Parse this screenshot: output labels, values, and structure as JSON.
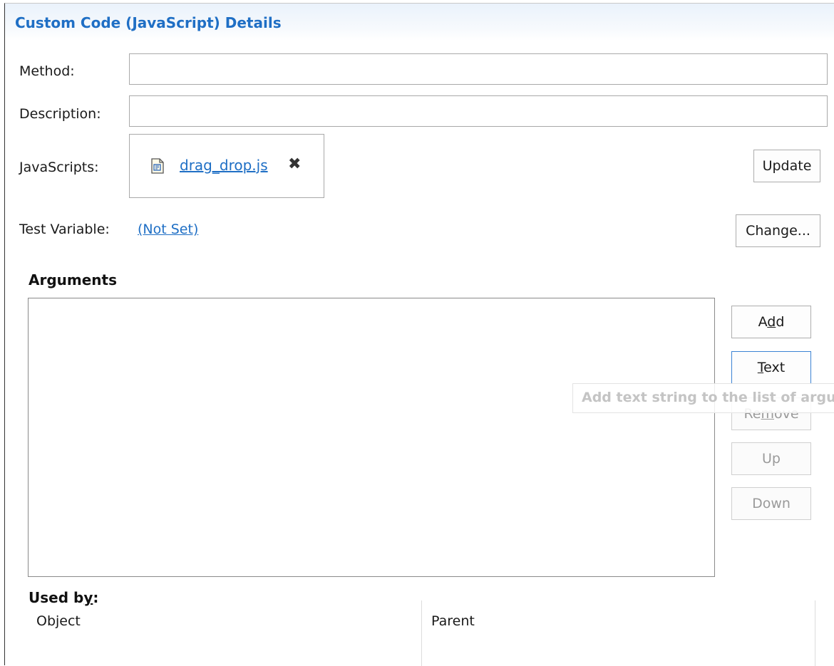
{
  "header": {
    "title": "Custom Code (JavaScript) Details"
  },
  "form": {
    "method_label": "Method:",
    "method_value": "",
    "description_label": "Description:",
    "description_value": "",
    "javascripts_label": "JavaScripts:",
    "javascript_file": "drag_drop.js",
    "file_icon": "js-file-icon",
    "remove_icon": "close-x-icon",
    "update_label": "Update",
    "test_variable_label": "Test Variable:",
    "test_variable_value": "(Not Set)",
    "change_label": "Change..."
  },
  "arguments": {
    "title": "Arguments",
    "items": [],
    "buttons": {
      "add": {
        "pre": "A",
        "mnemonic": "d",
        "post": "d",
        "enabled": true
      },
      "text": {
        "pre": "",
        "mnemonic": "T",
        "post": "ext",
        "enabled": true
      },
      "remove": {
        "pre": "Re",
        "mnemonic": "m",
        "post": "ove",
        "enabled": false
      },
      "up": {
        "label": "Up",
        "enabled": false
      },
      "down": {
        "label": "Down",
        "enabled": false
      }
    },
    "tooltip": "Add text string to the list of argu"
  },
  "used_by": {
    "title_pre": "Used b",
    "title_mnemonic": "y",
    "title_post": ":",
    "columns": [
      "Object",
      "Parent"
    ]
  },
  "colors": {
    "accent": "#1f6fc5",
    "header_bg": "#eaf2fb",
    "disabled_text": "#9a9a9a"
  }
}
